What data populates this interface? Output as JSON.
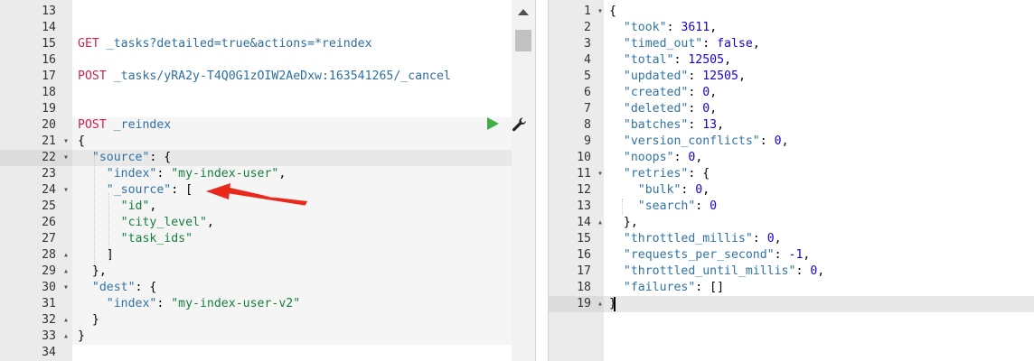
{
  "left_editor": {
    "lines": [
      {
        "num": "13",
        "fold": "",
        "tokens": []
      },
      {
        "num": "14",
        "fold": "",
        "tokens": []
      },
      {
        "num": "15",
        "fold": "",
        "tokens": [
          {
            "t": "GET ",
            "c": "m"
          },
          {
            "t": "_tasks?detailed=true&actions=*reindex",
            "c": "u"
          }
        ]
      },
      {
        "num": "16",
        "fold": "",
        "tokens": []
      },
      {
        "num": "17",
        "fold": "",
        "tokens": [
          {
            "t": "POST ",
            "c": "m"
          },
          {
            "t": "_tasks/yRA2y-T4Q0G1zOIW2AeDxw:163541265/_cancel",
            "c": "u"
          }
        ]
      },
      {
        "num": "18",
        "fold": "",
        "tokens": []
      },
      {
        "num": "19",
        "fold": "",
        "tokens": []
      },
      {
        "num": "20",
        "fold": "",
        "tokens": [
          {
            "t": "POST ",
            "c": "m"
          },
          {
            "t": "_reindex",
            "c": "u"
          }
        ]
      },
      {
        "num": "21",
        "fold": "▾",
        "tokens": [
          {
            "t": "{",
            "c": "p"
          }
        ]
      },
      {
        "num": "22",
        "fold": "▾",
        "tokens": [
          {
            "t": "  \"source\"",
            "c": "k"
          },
          {
            "t": ": {",
            "c": "p"
          }
        ]
      },
      {
        "num": "23",
        "fold": "",
        "tokens": [
          {
            "t": "    \"index\"",
            "c": "k"
          },
          {
            "t": ": ",
            "c": "p"
          },
          {
            "t": "\"my-index-user\"",
            "c": "s"
          },
          {
            "t": ",",
            "c": "p"
          }
        ]
      },
      {
        "num": "24",
        "fold": "▾",
        "tokens": [
          {
            "t": "    \"_source\"",
            "c": "k"
          },
          {
            "t": ": [",
            "c": "p"
          }
        ]
      },
      {
        "num": "25",
        "fold": "",
        "tokens": [
          {
            "t": "      \"id\"",
            "c": "s"
          },
          {
            "t": ",",
            "c": "p"
          }
        ]
      },
      {
        "num": "26",
        "fold": "",
        "tokens": [
          {
            "t": "      \"city_level\"",
            "c": "s"
          },
          {
            "t": ",",
            "c": "p"
          }
        ]
      },
      {
        "num": "27",
        "fold": "",
        "tokens": [
          {
            "t": "      \"task_ids\"",
            "c": "s"
          }
        ]
      },
      {
        "num": "28",
        "fold": "▴",
        "tokens": [
          {
            "t": "    ]",
            "c": "p"
          }
        ]
      },
      {
        "num": "29",
        "fold": "▴",
        "tokens": [
          {
            "t": "  },",
            "c": "p"
          }
        ]
      },
      {
        "num": "30",
        "fold": "▾",
        "tokens": [
          {
            "t": "  \"dest\"",
            "c": "k"
          },
          {
            "t": ": {",
            "c": "p"
          }
        ]
      },
      {
        "num": "31",
        "fold": "",
        "tokens": [
          {
            "t": "    \"index\"",
            "c": "k"
          },
          {
            "t": ": ",
            "c": "p"
          },
          {
            "t": "\"my-index-user-v2\"",
            "c": "s"
          }
        ]
      },
      {
        "num": "32",
        "fold": "▴",
        "tokens": [
          {
            "t": "  }",
            "c": "p"
          }
        ]
      },
      {
        "num": "33",
        "fold": "▴",
        "tokens": [
          {
            "t": "}",
            "c": "p"
          }
        ]
      },
      {
        "num": "34",
        "fold": "",
        "tokens": []
      }
    ]
  },
  "right_editor": {
    "lines": [
      {
        "num": "1",
        "fold": "▾",
        "tokens": [
          {
            "t": "{",
            "c": "p"
          }
        ]
      },
      {
        "num": "2",
        "fold": "",
        "tokens": [
          {
            "t": "  \"took\"",
            "c": "k"
          },
          {
            "t": ": ",
            "c": "p"
          },
          {
            "t": "3611",
            "c": "n"
          },
          {
            "t": ",",
            "c": "p"
          }
        ]
      },
      {
        "num": "3",
        "fold": "",
        "tokens": [
          {
            "t": "  \"timed_out\"",
            "c": "k"
          },
          {
            "t": ": ",
            "c": "p"
          },
          {
            "t": "false",
            "c": "b"
          },
          {
            "t": ",",
            "c": "p"
          }
        ]
      },
      {
        "num": "4",
        "fold": "",
        "tokens": [
          {
            "t": "  \"total\"",
            "c": "k"
          },
          {
            "t": ": ",
            "c": "p"
          },
          {
            "t": "12505",
            "c": "n"
          },
          {
            "t": ",",
            "c": "p"
          }
        ]
      },
      {
        "num": "5",
        "fold": "",
        "tokens": [
          {
            "t": "  \"updated\"",
            "c": "k"
          },
          {
            "t": ": ",
            "c": "p"
          },
          {
            "t": "12505",
            "c": "n"
          },
          {
            "t": ",",
            "c": "p"
          }
        ]
      },
      {
        "num": "6",
        "fold": "",
        "tokens": [
          {
            "t": "  \"created\"",
            "c": "k"
          },
          {
            "t": ": ",
            "c": "p"
          },
          {
            "t": "0",
            "c": "n"
          },
          {
            "t": ",",
            "c": "p"
          }
        ]
      },
      {
        "num": "7",
        "fold": "",
        "tokens": [
          {
            "t": "  \"deleted\"",
            "c": "k"
          },
          {
            "t": ": ",
            "c": "p"
          },
          {
            "t": "0",
            "c": "n"
          },
          {
            "t": ",",
            "c": "p"
          }
        ]
      },
      {
        "num": "8",
        "fold": "",
        "tokens": [
          {
            "t": "  \"batches\"",
            "c": "k"
          },
          {
            "t": ": ",
            "c": "p"
          },
          {
            "t": "13",
            "c": "n"
          },
          {
            "t": ",",
            "c": "p"
          }
        ]
      },
      {
        "num": "9",
        "fold": "",
        "tokens": [
          {
            "t": "  \"version_conflicts\"",
            "c": "k"
          },
          {
            "t": ": ",
            "c": "p"
          },
          {
            "t": "0",
            "c": "n"
          },
          {
            "t": ",",
            "c": "p"
          }
        ]
      },
      {
        "num": "10",
        "fold": "",
        "tokens": [
          {
            "t": "  \"noops\"",
            "c": "k"
          },
          {
            "t": ": ",
            "c": "p"
          },
          {
            "t": "0",
            "c": "n"
          },
          {
            "t": ",",
            "c": "p"
          }
        ]
      },
      {
        "num": "11",
        "fold": "▾",
        "tokens": [
          {
            "t": "  \"retries\"",
            "c": "k"
          },
          {
            "t": ": {",
            "c": "p"
          }
        ]
      },
      {
        "num": "12",
        "fold": "",
        "tokens": [
          {
            "t": "    \"bulk\"",
            "c": "k"
          },
          {
            "t": ": ",
            "c": "p"
          },
          {
            "t": "0",
            "c": "n"
          },
          {
            "t": ",",
            "c": "p"
          }
        ]
      },
      {
        "num": "13",
        "fold": "",
        "tokens": [
          {
            "t": "    \"search\"",
            "c": "k"
          },
          {
            "t": ": ",
            "c": "p"
          },
          {
            "t": "0",
            "c": "n"
          }
        ]
      },
      {
        "num": "14",
        "fold": "▴",
        "tokens": [
          {
            "t": "  },",
            "c": "p"
          }
        ]
      },
      {
        "num": "15",
        "fold": "",
        "tokens": [
          {
            "t": "  \"throttled_millis\"",
            "c": "k"
          },
          {
            "t": ": ",
            "c": "p"
          },
          {
            "t": "0",
            "c": "n"
          },
          {
            "t": ",",
            "c": "p"
          }
        ]
      },
      {
        "num": "16",
        "fold": "",
        "tokens": [
          {
            "t": "  \"requests_per_second\"",
            "c": "k"
          },
          {
            "t": ": ",
            "c": "p"
          },
          {
            "t": "-1",
            "c": "n"
          },
          {
            "t": ",",
            "c": "p"
          }
        ]
      },
      {
        "num": "17",
        "fold": "",
        "tokens": [
          {
            "t": "  \"throttled_until_millis\"",
            "c": "k"
          },
          {
            "t": ": ",
            "c": "p"
          },
          {
            "t": "0",
            "c": "n"
          },
          {
            "t": ",",
            "c": "p"
          }
        ]
      },
      {
        "num": "18",
        "fold": "",
        "tokens": [
          {
            "t": "  \"failures\"",
            "c": "k"
          },
          {
            "t": ": []",
            "c": "p"
          }
        ]
      },
      {
        "num": "19",
        "fold": "▴",
        "tokens": [
          {
            "t": "}",
            "c": "p"
          }
        ]
      }
    ]
  },
  "icons": {
    "run": "play-icon",
    "settings": "wrench-icon",
    "annotation": "red-arrow-icon"
  },
  "colors": {
    "method": "#c7254e",
    "url": "#2f6f9f",
    "key": "#3173a4",
    "string": "#177e3e",
    "number": "#1c00cf",
    "run_button": "#3fae49",
    "annotation_arrow": "#e8291c"
  }
}
